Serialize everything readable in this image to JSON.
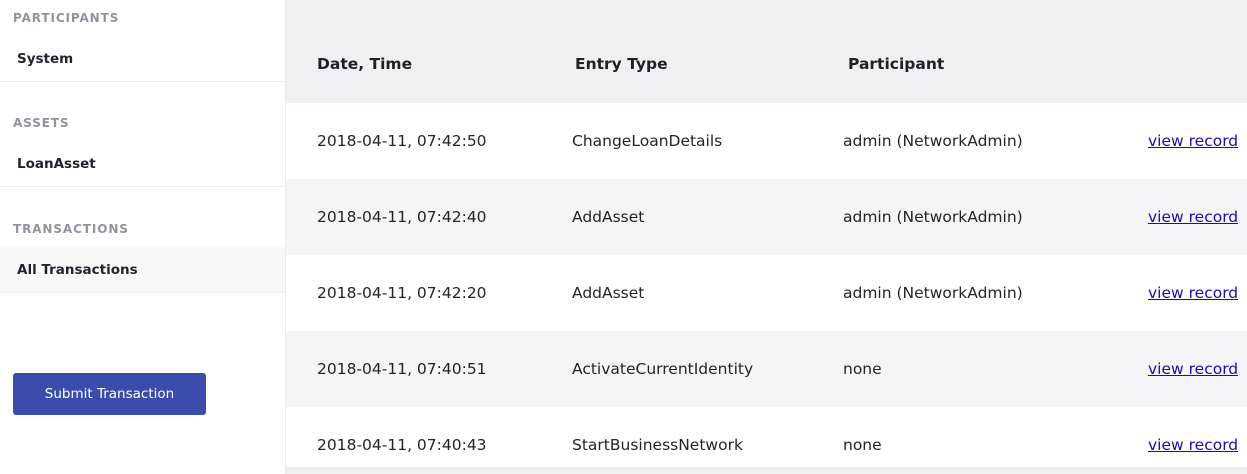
{
  "sidebar": {
    "participants_header": "PARTICIPANTS",
    "participants_items": [
      {
        "label": "System"
      }
    ],
    "assets_header": "ASSETS",
    "assets_items": [
      {
        "label": "LoanAsset"
      }
    ],
    "transactions_header": "TRANSACTIONS",
    "transactions_items": [
      {
        "label": "All Transactions"
      }
    ],
    "submit_label": "Submit Transaction"
  },
  "table": {
    "headers": [
      "Date, Time",
      "Entry Type",
      "Participant"
    ],
    "rows": [
      {
        "datetime": "2018-04-11, 07:42:50",
        "entry_type": "ChangeLoanDetails",
        "participant": "admin (NetworkAdmin)",
        "link": "view record"
      },
      {
        "datetime": "2018-04-11, 07:42:40",
        "entry_type": "AddAsset",
        "participant": "admin (NetworkAdmin)",
        "link": "view record"
      },
      {
        "datetime": "2018-04-11, 07:42:20",
        "entry_type": "AddAsset",
        "participant": "admin (NetworkAdmin)",
        "link": "view record"
      },
      {
        "datetime": "2018-04-11, 07:40:51",
        "entry_type": "ActivateCurrentIdentity",
        "participant": "none",
        "link": "view record"
      },
      {
        "datetime": "2018-04-11, 07:40:43",
        "entry_type": "StartBusinessNetwork",
        "participant": "none",
        "link": "view record"
      }
    ]
  },
  "colors": {
    "accent": "#3b4cad",
    "link": "#1a0dab",
    "header_bg": "#eff0f3"
  }
}
